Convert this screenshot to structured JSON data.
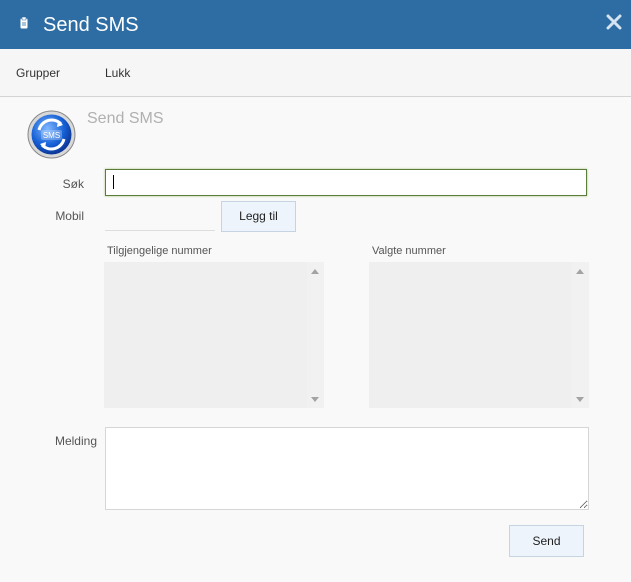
{
  "window": {
    "title": "Send SMS",
    "title_color": "#2e6da4",
    "title_icon": "clipboard-icon",
    "close_icon": "close-icon"
  },
  "menu": {
    "items": [
      {
        "label": "Grupper"
      },
      {
        "label": "Lukk"
      }
    ]
  },
  "header": {
    "logo_text": "SMS",
    "title": "Send SMS"
  },
  "form": {
    "sok_label": "Søk",
    "sok_value": "",
    "mobil_label": "Mobil",
    "mobil_value": "",
    "add_button": "Legg til",
    "available_title": "Tilgjengelige nummer",
    "selected_title": "Valgte nummer",
    "melding_label": "Melding",
    "melding_value": "",
    "send_button": "Send"
  }
}
